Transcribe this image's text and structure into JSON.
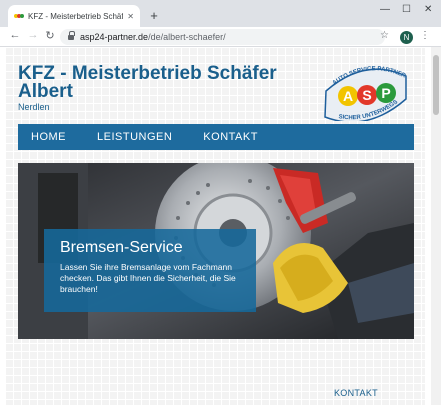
{
  "browser": {
    "tab_title": "KFZ - Meisterbetrieb Schäfer Albert",
    "tab_close": "✕",
    "new_tab": "+",
    "url_host": "asp24-partner.de",
    "url_path": "/de/albert-schaefer/",
    "profile_initial": "N",
    "window_controls": [
      "—",
      "☐",
      "✕"
    ],
    "nav_icons": [
      "back-icon",
      "forward-icon",
      "reload-icon"
    ]
  },
  "header": {
    "title": "KFZ - Meisterbetrieb Schäfer Albert",
    "location": "Nerdlen",
    "logo": {
      "top_text": "AUTO SERVICE PARTNER",
      "bottom_text": "SICHER UNTERWEGS",
      "letters": [
        "A",
        "S",
        "P"
      ],
      "colors": [
        "#f2c400",
        "#e2382a",
        "#2b9a3c"
      ]
    }
  },
  "nav": {
    "items": [
      "HOME",
      "LEISTUNGEN",
      "KONTAKT"
    ],
    "color": "#1e6b9e"
  },
  "hero": {
    "title": "Bremsen-Service",
    "text": "Lassen Sie ihre Bremsanlage vom Fachmann checken. Das gibt Ihnen die Sicherheit, die Sie brauchen!"
  },
  "footer": {
    "link": "KONTAKT"
  }
}
